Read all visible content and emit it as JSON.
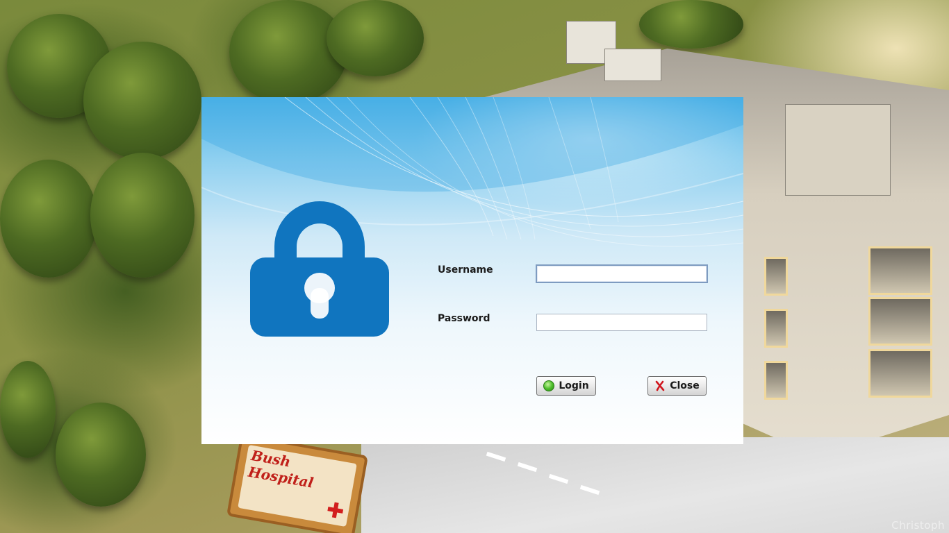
{
  "login_dialog": {
    "username_label": "Username",
    "username_value": "",
    "password_label": "Password",
    "password_value": "",
    "login_button": "Login",
    "close_button": "Close",
    "icons": {
      "lock": "lock-icon",
      "login": "green-orb-icon",
      "close": "red-x-icon"
    },
    "colors": {
      "lock": "#1075bf",
      "dialog_top": "#4fb4e8",
      "dialog_bottom": "#ffffff",
      "close_x": "#d0141c"
    }
  },
  "wallpaper": {
    "sign_text": "Bush Hospital",
    "watermark": "Christoph"
  }
}
